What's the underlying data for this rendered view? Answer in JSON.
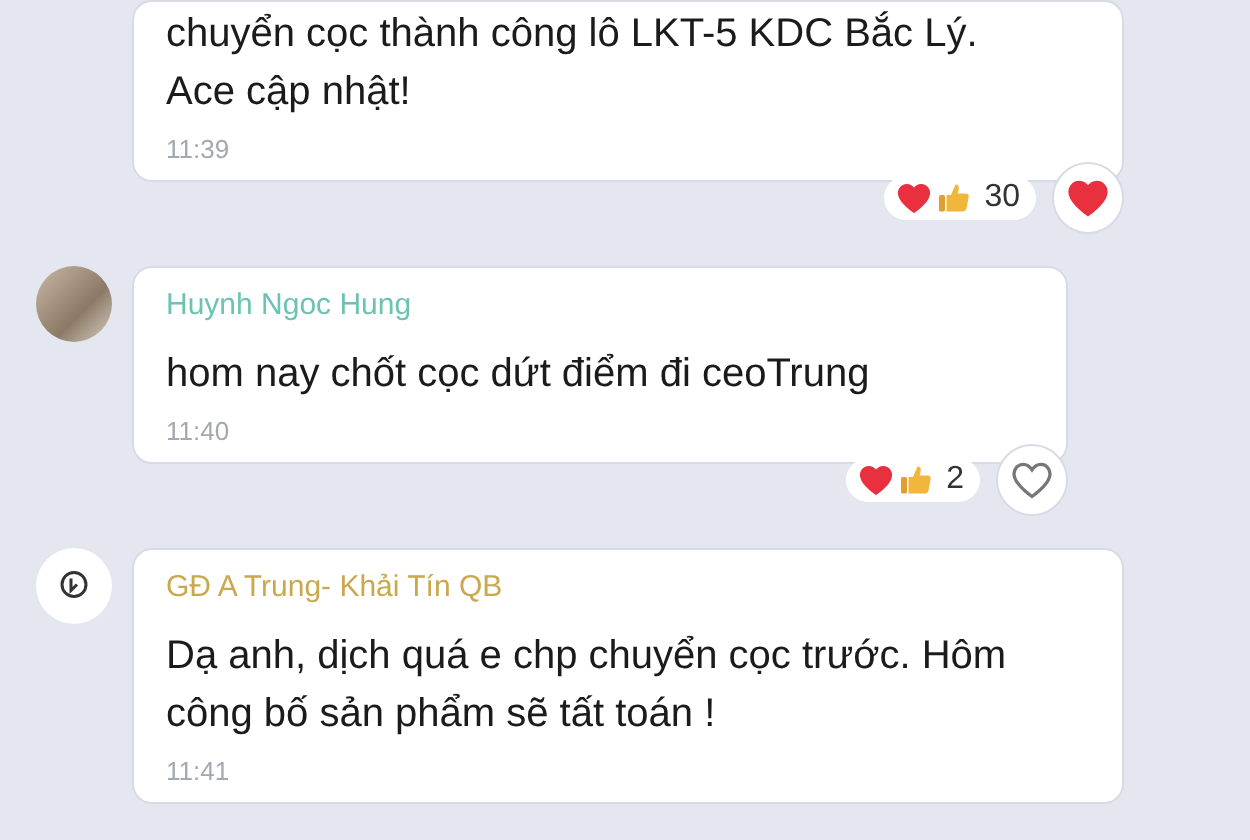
{
  "messages": [
    {
      "kind": "continuation",
      "text": "chuyển cọc thành công lô LKT-5 KDC Bắc Lý. Ace cập nhật!",
      "time": "11:39",
      "reactions": {
        "count": "30",
        "reacted": true
      }
    },
    {
      "kind": "photo",
      "sender": "Huynh Ngoc Hung",
      "color": "#6cc3b4",
      "text": "hom nay chốt cọc dứt điểm đi ceoTrung",
      "time": "11:40",
      "reactions": {
        "count": "2",
        "reacted": false
      }
    },
    {
      "kind": "logo",
      "sender": "GĐ A Trung- Khải Tín QB",
      "color": "#c9a84e",
      "text": "Dạ anh, dịch quá e chp chuyển cọc trước. Hôm công bố sản phẩm sẽ tất toán !",
      "time": "11:41"
    }
  ]
}
